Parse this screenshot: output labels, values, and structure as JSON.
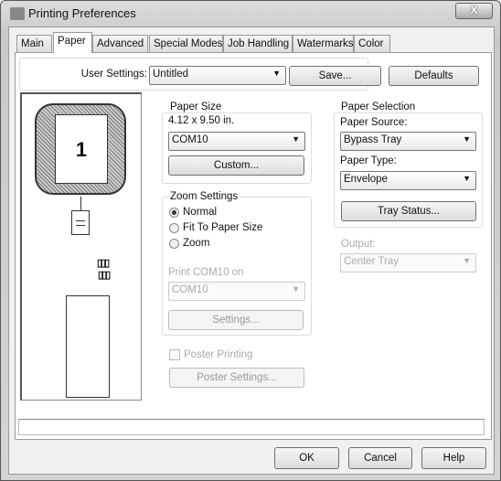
{
  "window": {
    "title": "Printing Preferences",
    "close": "X"
  },
  "tabs": [
    {
      "label": "Main"
    },
    {
      "label": "Paper",
      "selected": true
    },
    {
      "label": "Advanced"
    },
    {
      "label": "Special Modes"
    },
    {
      "label": "Job Handling"
    },
    {
      "label": "Watermarks"
    },
    {
      "label": "Color"
    }
  ],
  "user_settings": {
    "label": "User Settings:",
    "value": "Untitled",
    "save": "Save...",
    "defaults": "Defaults"
  },
  "preview": {
    "page_number": "1"
  },
  "paper_size": {
    "legend": "Paper Size",
    "dimensions": "4.12 x 9.50 in.",
    "value": "COM10",
    "custom": "Custom..."
  },
  "zoom": {
    "legend": "Zoom Settings",
    "options": [
      {
        "label": "Normal",
        "checked": true
      },
      {
        "label": "Fit To Paper Size",
        "checked": false
      },
      {
        "label": "Zoom",
        "checked": false
      }
    ],
    "print_on_label": "Print COM10 on",
    "print_on_value": "COM10",
    "settings": "Settings..."
  },
  "poster": {
    "label": "Poster Printing",
    "checked": false,
    "settings": "Poster Settings..."
  },
  "paper_selection": {
    "legend": "Paper Selection",
    "source_label": "Paper Source:",
    "source_value": "Bypass Tray",
    "type_label": "Paper Type:",
    "type_value": "Envelope",
    "tray_status": "Tray Status..."
  },
  "output": {
    "label": "Output:",
    "value": "Center Tray"
  },
  "footer": {
    "ok": "OK",
    "cancel": "Cancel",
    "help": "Help"
  }
}
